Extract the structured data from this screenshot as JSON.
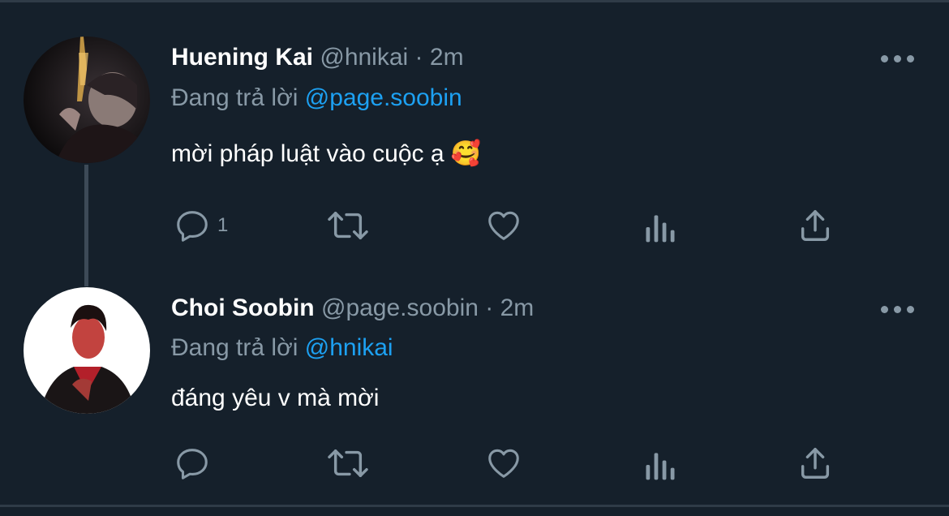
{
  "colors": {
    "background": "#15202b",
    "text_primary": "#ffffff",
    "text_secondary": "#8899a6",
    "mention": "#1da1f2",
    "divider": "#2f3b47"
  },
  "tweets": [
    {
      "name": "Huening Kai",
      "handle": "@hnikai",
      "separator": "·",
      "time": "2m",
      "reply_prefix": "Đang trả lời",
      "reply_to": "@page.soobin",
      "text": "mời pháp luật vào cuộc ạ 🥰",
      "avatar_icon": "avatar-photo",
      "actions": {
        "reply_icon": "reply-icon",
        "reply_count": "1",
        "retweet_icon": "retweet-icon",
        "like_icon": "heart-icon",
        "analytics_icon": "analytics-icon",
        "share_icon": "share-icon"
      }
    },
    {
      "name": "Choi Soobin",
      "handle": "@page.soobin",
      "separator": "·",
      "time": "2m",
      "reply_prefix": "Đang trả lời",
      "reply_to": "@hnikai",
      "text": "đáng yêu v mà mời",
      "avatar_icon": "avatar-photo",
      "actions": {
        "reply_icon": "reply-icon",
        "reply_count": "",
        "retweet_icon": "retweet-icon",
        "like_icon": "heart-icon",
        "analytics_icon": "analytics-icon",
        "share_icon": "share-icon"
      }
    }
  ]
}
